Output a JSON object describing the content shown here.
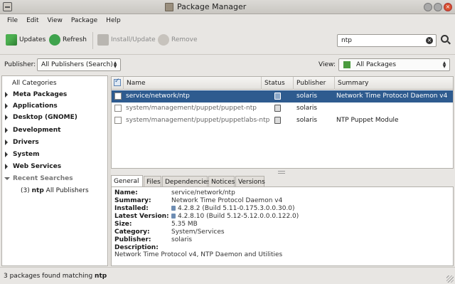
{
  "window": {
    "title": "Package Manager"
  },
  "menu": [
    "File",
    "Edit",
    "View",
    "Package",
    "Help"
  ],
  "toolbar": {
    "updates": "Updates",
    "refresh": "Refresh",
    "install_update": "Install/Update",
    "remove": "Remove"
  },
  "search": {
    "value": "ntp"
  },
  "filters": {
    "publisher_label": "Publisher:",
    "publisher_value": "All Publishers (Search)",
    "view_label": "View:",
    "view_value": "All Packages"
  },
  "categories": [
    {
      "label": "All Categories",
      "style": "plain",
      "arrow": "none"
    },
    {
      "label": "Meta Packages",
      "style": "bold",
      "arrow": "closed"
    },
    {
      "label": "Applications",
      "style": "bold",
      "arrow": "closed"
    },
    {
      "label": "Desktop (GNOME)",
      "style": "bold",
      "arrow": "closed"
    },
    {
      "label": "Development",
      "style": "bold",
      "arrow": "closed"
    },
    {
      "label": "Drivers",
      "style": "bold",
      "arrow": "closed"
    },
    {
      "label": "System",
      "style": "bold",
      "arrow": "closed"
    },
    {
      "label": "Web Services",
      "style": "bold",
      "arrow": "closed"
    },
    {
      "label": "Recent Searches",
      "style": "gray",
      "arrow": "open"
    }
  ],
  "recent_search": {
    "count": "(3)",
    "term": "ntp",
    "rest": "All Publishers"
  },
  "table": {
    "columns": [
      "Name",
      "Status",
      "Publisher",
      "Summary"
    ],
    "rows": [
      {
        "name": "service/network/ntp",
        "publisher": "solaris",
        "summary": "Network Time Protocol Daemon v4",
        "selected": true
      },
      {
        "name": "system/management/puppet/puppet-ntp",
        "publisher": "solaris",
        "summary": "",
        "selected": false
      },
      {
        "name": "system/management/puppet/puppetlabs-ntp",
        "publisher": "solaris",
        "summary": "NTP Puppet Module",
        "selected": false
      }
    ]
  },
  "tabs": [
    "General",
    "Files",
    "Dependencies",
    "Notices",
    "Versions"
  ],
  "details": {
    "name_label": "Name:",
    "name": "service/network/ntp",
    "summary_label": "Summary:",
    "summary": "Network Time Protocol Daemon v4",
    "installed_label": "Installed:",
    "installed": "4.2.8.2 (Build 5.11-0.175.3.0.0.30.0)",
    "latest_label": "Latest Version:",
    "latest": "4.2.8.10 (Build 5.12-5.12.0.0.0.122.0)",
    "size_label": "Size:",
    "size": "5.35 MB",
    "category_label": "Category:",
    "category": "System/Services",
    "publisher_label": "Publisher:",
    "publisher": "solaris",
    "description_label": "Description:",
    "description": "Network Time Protocol v4, NTP Daemon and Utilities"
  },
  "status": {
    "prefix": "3 packages found matching",
    "term": "ntp"
  }
}
